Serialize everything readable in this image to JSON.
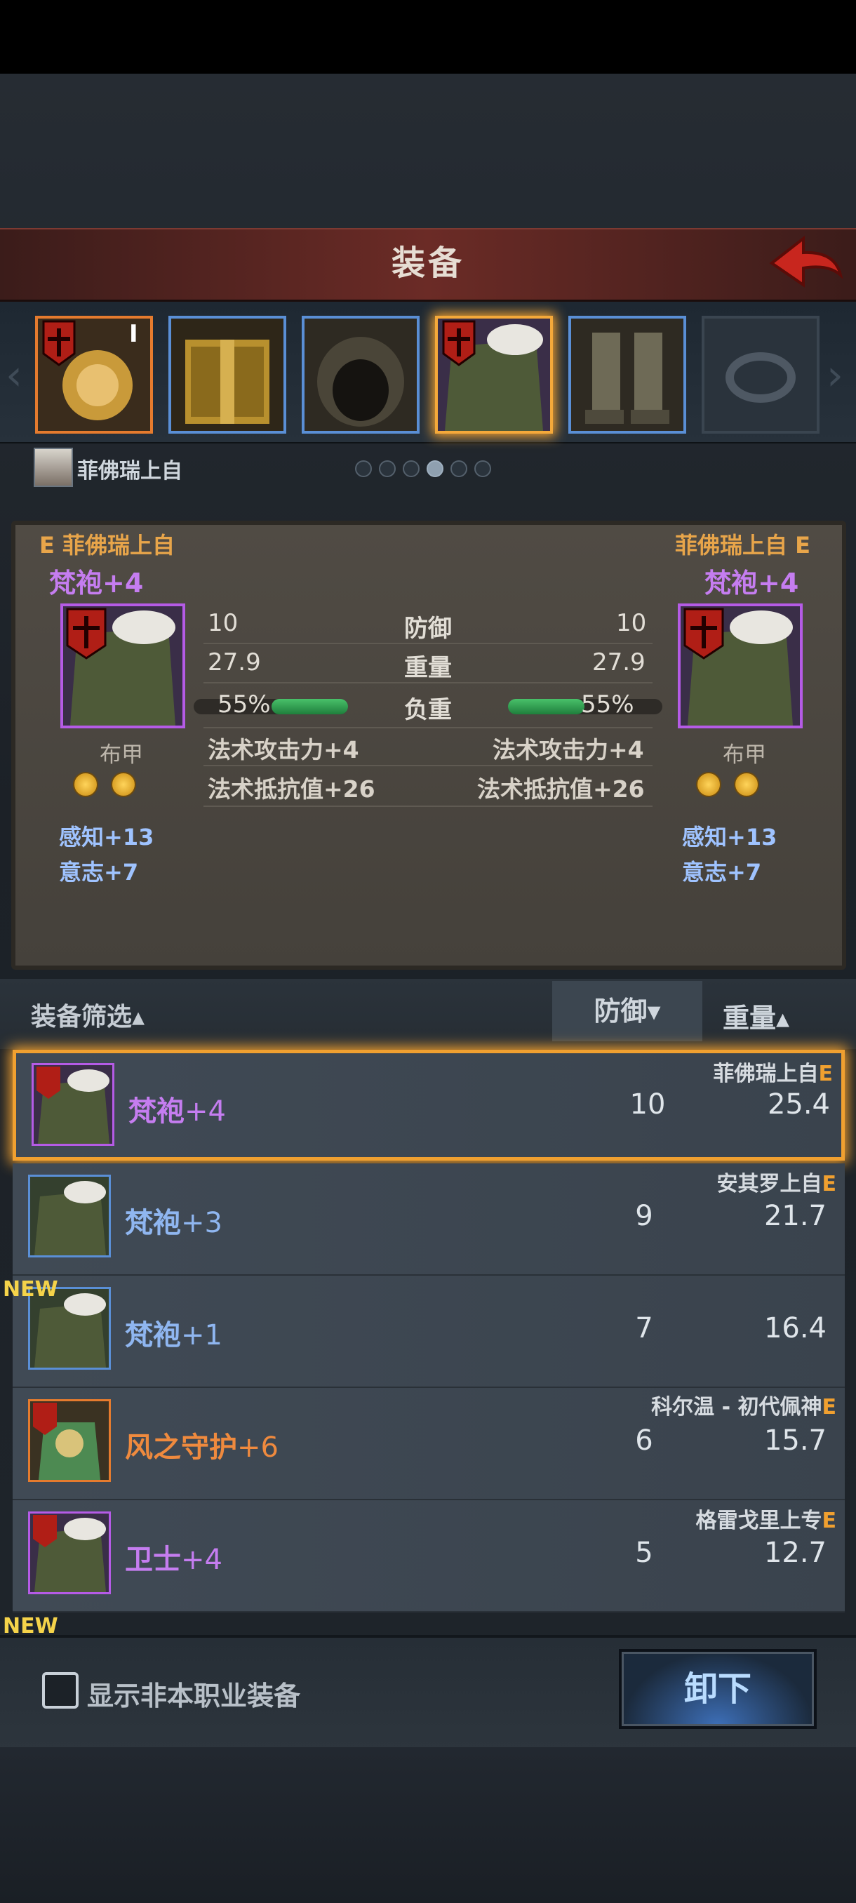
{
  "header": {
    "title": "装备"
  },
  "character": {
    "name": "菲佛瑞上自"
  },
  "slots": [
    {
      "icon": "helm-icon",
      "tier": "I"
    },
    {
      "icon": "chest-trunk-icon"
    },
    {
      "icon": "hood-icon"
    },
    {
      "icon": "robe-icon"
    },
    {
      "icon": "boots-icon"
    },
    {
      "icon": "ring-icon"
    }
  ],
  "page_indicator": {
    "total": 6,
    "active": 4
  },
  "compare": {
    "left": {
      "owner": "E 菲佛瑞上自",
      "name": "梵袍+4",
      "type": "布甲",
      "defense": "10",
      "weight": "27.9",
      "load": "55%",
      "load_fraction": 0.55,
      "bonus1": "法术攻击力+4",
      "bonus2": "法术抵抗值+26",
      "attr1": "感知+13",
      "attr2": "意志+7"
    },
    "right": {
      "owner": "菲佛瑞上自 E",
      "name": "梵袍+4",
      "type": "布甲",
      "defense": "10",
      "weight": "27.9",
      "load": "55%",
      "load_fraction": 0.55,
      "bonus1": "法术攻击力+4",
      "bonus2": "法术抵抗值+26",
      "attr1": "感知+13",
      "attr2": "意志+7"
    },
    "labels": {
      "defense": "防御",
      "weight": "重量",
      "load": "负重"
    }
  },
  "filter": {
    "label": "装备筛选▴",
    "sort_defense": "防御▾",
    "sort_weight": "重量▴"
  },
  "items": [
    {
      "name": "梵袍",
      "plus": "+4",
      "defense": "10",
      "weight": "25.4",
      "owner": "菲佛瑞上自",
      "owner_tag": "E",
      "new": "",
      "name_color": "#c57df0"
    },
    {
      "name": "梵袍",
      "plus": "+3",
      "defense": "9",
      "weight": "21.7",
      "owner": "安其罗上自",
      "owner_tag": "E",
      "new": "",
      "name_color": "#8fb6f0"
    },
    {
      "name": "梵袍",
      "plus": "+1",
      "defense": "7",
      "weight": "16.4",
      "owner": "",
      "owner_tag": "",
      "new": "NEW",
      "name_color": "#8fb6f0"
    },
    {
      "name": "风之守护",
      "plus": "+6",
      "defense": "6",
      "weight": "15.7",
      "owner": "科尔温 - 初代佩神",
      "owner_tag": "E",
      "new": "",
      "name_color": "#ef8a3e"
    },
    {
      "name": "卫士",
      "plus": "+4",
      "defense": "5",
      "weight": "12.7",
      "owner": "格雷戈里上专",
      "owner_tag": "E",
      "new": "",
      "name_color": "#c57df0"
    }
  ],
  "partial_new_tag": "NEW",
  "bottom": {
    "checkbox_label": "显示非本职业装备",
    "unequip": "卸下"
  },
  "colors": {
    "accent_orange": "#f0a030",
    "rare_purple": "#c57df0",
    "common_blue": "#5a8fd6"
  }
}
